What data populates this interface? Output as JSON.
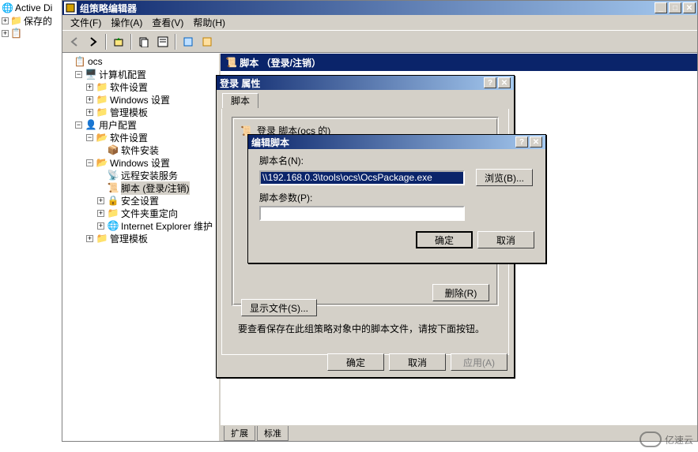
{
  "bgTree": {
    "item1": "Active Di",
    "item2": "保存的"
  },
  "window": {
    "title": "组策略编辑器"
  },
  "menu": {
    "file": "文件(F)",
    "action": "操作(A)",
    "view": "查看(V)",
    "help": "帮助(H)"
  },
  "tree": {
    "root": "ocs",
    "computerConfig": "计算机配置",
    "softwareSettings": "软件设置",
    "windowsSettings": "Windows 设置",
    "adminTemplates": "管理模板",
    "userConfig": "用户配置",
    "softwareInstall": "软件安装",
    "remoteInstall": "远程安装服务",
    "scripts": "脚本 (登录/注销)",
    "security": "安全设置",
    "folderRedir": "文件夹重定向",
    "ie": "Internet Explorer 维护"
  },
  "rightHeader": "脚本 （登录/注销）",
  "tabs": {
    "extended": "扩展",
    "standard": "标准"
  },
  "dialog1": {
    "title": "登录 属性",
    "tab": "脚本",
    "groupHeader": "登录 脚本(ocs 的)",
    "deleteBtn": "删除(R)",
    "hint": "要查看保存在此组策略对象中的脚本文件，请按下面按钮。",
    "showFiles": "显示文件(S)...",
    "ok": "确定",
    "cancel": "取消",
    "apply": "应用(A)"
  },
  "dialog2": {
    "title": "编辑脚本",
    "scriptNameLabel": "脚本名(N):",
    "scriptNameValue": "\\\\192.168.0.3\\tools\\ocs\\OcsPackage.exe",
    "browse": "浏览(B)...",
    "scriptParamsLabel": "脚本参数(P):",
    "scriptParamsValue": "",
    "ok": "确定",
    "cancel": "取消"
  },
  "watermark": "亿速云"
}
